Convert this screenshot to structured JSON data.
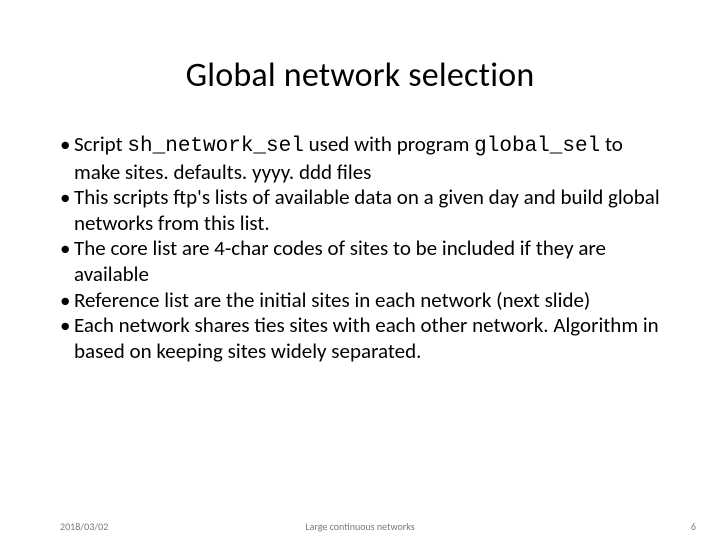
{
  "title": "Global network selection",
  "bullets": [
    {
      "pre": "Script ",
      "code1": "sh_network_sel",
      "mid": " used with program ",
      "code2": "global_sel",
      "post": " to make sites. defaults. yyyy. ddd files"
    },
    {
      "pre": "This scripts ftp's lists of available data on a given day and build global networks from this list."
    },
    {
      "pre": "The core list are 4-char codes of sites to be included if they are available"
    },
    {
      "pre": "Reference list are the initial sites in each network (next slide)"
    },
    {
      "pre": "Each network shares ties sites with each other network. Algorithm in based on keeping sites widely separated."
    }
  ],
  "footer": {
    "date": "2018/03/02",
    "center": "Large continuous networks",
    "page": "6"
  }
}
